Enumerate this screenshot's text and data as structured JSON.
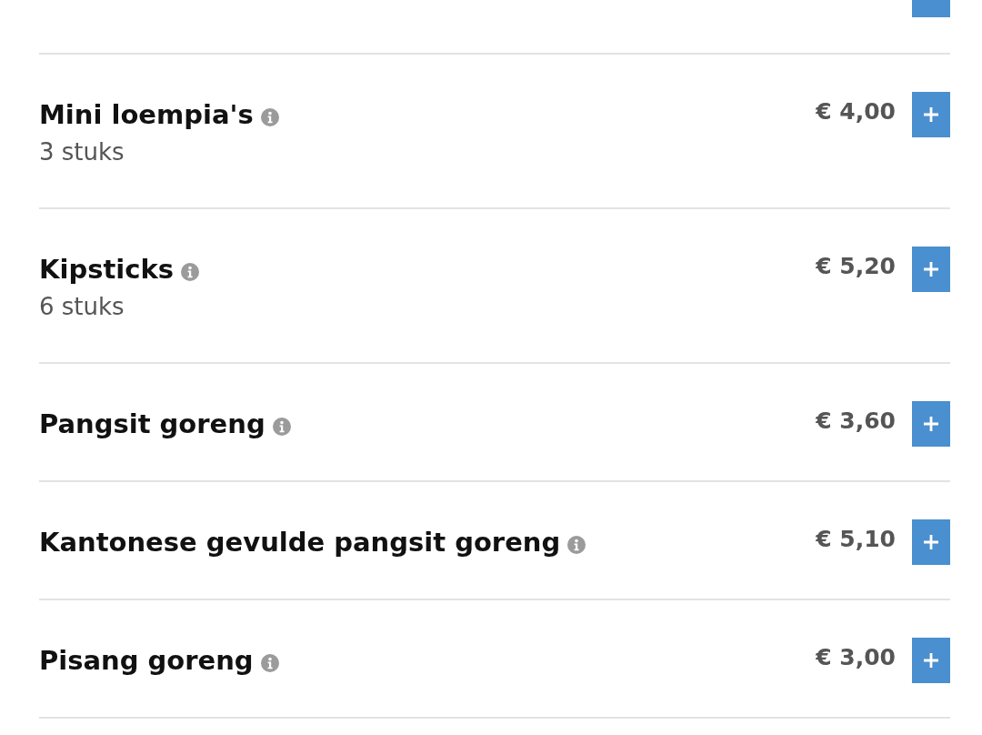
{
  "cut_off_row_above": true,
  "menu_items": [
    {
      "name": "Mini loempia's",
      "description": "3 stuks",
      "price": "€ 4,00"
    },
    {
      "name": "Kipsticks",
      "description": "6 stuks",
      "price": "€ 5,20"
    },
    {
      "name": "Pangsit goreng",
      "price": "€ 3,60"
    },
    {
      "name": "Kantonese gevulde pangsit goreng",
      "price": "€ 5,10"
    },
    {
      "name": "Pisang goreng",
      "price": "€ 3,00"
    }
  ]
}
